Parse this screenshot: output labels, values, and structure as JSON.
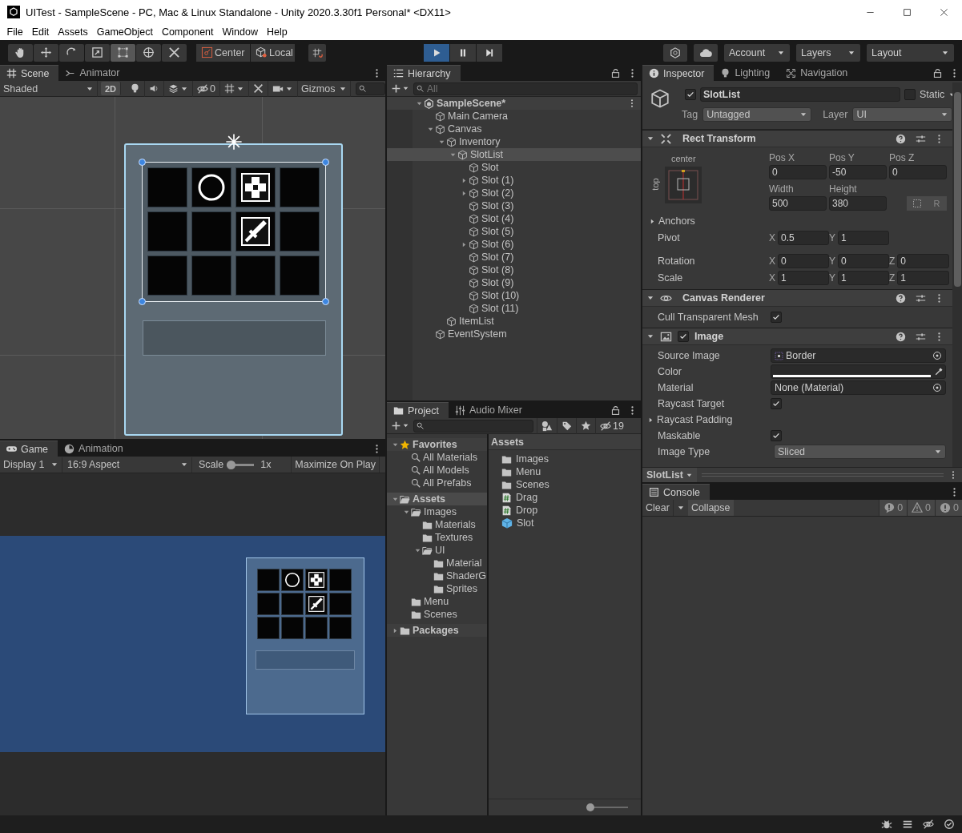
{
  "window": {
    "title": "UITest - SampleScene - PC, Mac & Linux Standalone - Unity 2020.3.30f1 Personal* <DX11>"
  },
  "menu": [
    "File",
    "Edit",
    "Assets",
    "GameObject",
    "Component",
    "Window",
    "Help"
  ],
  "toolbar": {
    "tools": [
      {
        "kind": "hand",
        "selected": false
      },
      {
        "kind": "move",
        "selected": false
      },
      {
        "kind": "rotate",
        "selected": false
      },
      {
        "kind": "scale",
        "selected": false
      },
      {
        "kind": "rect",
        "selected": true
      },
      {
        "kind": "transform",
        "selected": false
      },
      {
        "kind": "custom",
        "selected": false
      }
    ],
    "pivot": "Center",
    "space": "Local",
    "play": [
      {
        "kind": "play",
        "selected": true
      },
      {
        "kind": "pause",
        "selected": false
      },
      {
        "kind": "step",
        "selected": false
      }
    ],
    "account": "Account",
    "layers": "Layers",
    "layout": "Layout"
  },
  "inventory": {
    "slots": [
      {
        "kind": "empty"
      },
      {
        "kind": "ring"
      },
      {
        "kind": "cross"
      },
      {
        "kind": "empty"
      },
      {
        "kind": "empty"
      },
      {
        "kind": "empty"
      },
      {
        "kind": "sword"
      },
      {
        "kind": "empty"
      },
      {
        "kind": "empty"
      },
      {
        "kind": "empty"
      },
      {
        "kind": "empty"
      },
      {
        "kind": "empty"
      }
    ]
  },
  "scene": {
    "tabs": [
      {
        "label": "Scene",
        "selected": true
      },
      {
        "label": "Animator",
        "selected": false
      }
    ],
    "draw_mode": "Shaded",
    "mode_2d": "2D",
    "hidden_count": "0",
    "gizmos": "Gizmos"
  },
  "game": {
    "tabs": [
      {
        "label": "Game",
        "selected": true
      },
      {
        "label": "Animation",
        "selected": false
      }
    ],
    "display": "Display 1",
    "aspect": "16:9 Aspect",
    "scale_label": "Scale",
    "scale_slider": {
      "level": 0
    },
    "scale": "1x",
    "maximize": "Maximize On Play"
  },
  "hierarchy": {
    "tabs": [
      {
        "label": "Hierarchy",
        "selected": true
      }
    ],
    "search_placeholder": "All",
    "tree": [
      {
        "name": "SampleScene*",
        "kind": "scene",
        "expanded": true,
        "selected": false,
        "children": [
          {
            "name": "Main Camera",
            "selected": false
          },
          {
            "name": "Canvas",
            "expanded": true,
            "selected": false,
            "children": [
              {
                "name": "Inventory",
                "expanded": true,
                "selected": false,
                "children": [
                  {
                    "name": "SlotList",
                    "expanded": true,
                    "selected": true,
                    "children": [
                      {
                        "name": "Slot",
                        "selected": false
                      },
                      {
                        "name": "Slot (1)",
                        "expanded": false,
                        "selected": false
                      },
                      {
                        "name": "Slot (2)",
                        "expanded": false,
                        "selected": false
                      },
                      {
                        "name": "Slot (3)",
                        "selected": false
                      },
                      {
                        "name": "Slot (4)",
                        "selected": false
                      },
                      {
                        "name": "Slot (5)",
                        "selected": false
                      },
                      {
                        "name": "Slot (6)",
                        "expanded": false,
                        "selected": false
                      },
                      {
                        "name": "Slot (7)",
                        "selected": false
                      },
                      {
                        "name": "Slot (8)",
                        "selected": false
                      },
                      {
                        "name": "Slot (9)",
                        "selected": false
                      },
                      {
                        "name": "Slot (10)",
                        "selected": false
                      },
                      {
                        "name": "Slot (11)",
                        "selected": false
                      }
                    ]
                  }
                ]
              },
              {
                "name": "ItemList",
                "selected": false
              }
            ]
          },
          {
            "name": "EventSystem",
            "selected": false
          }
        ]
      }
    ]
  },
  "project": {
    "tabs": [
      {
        "label": "Project",
        "selected": true
      },
      {
        "label": "Audio Mixer",
        "selected": false
      }
    ],
    "hidden_count": "19",
    "tree": [
      {
        "name": "Favorites",
        "kind": "favorites",
        "expanded": true,
        "selected": false,
        "children": [
          {
            "name": "All Materials",
            "kind": "search",
            "selected": false
          },
          {
            "name": "All Models",
            "kind": "search",
            "selected": false
          },
          {
            "name": "All Prefabs",
            "kind": "search",
            "selected": false
          }
        ]
      },
      {
        "name": "Assets",
        "kind": "folder",
        "expanded": true,
        "selected": true,
        "children": [
          {
            "name": "Images",
            "kind": "folder",
            "expanded": true,
            "selected": false,
            "children": [
              {
                "name": "Materials",
                "kind": "folder",
                "selected": false
              },
              {
                "name": "Textures",
                "kind": "folder",
                "selected": false
              },
              {
                "name": "UI",
                "kind": "folder",
                "expanded": true,
                "selected": false,
                "children": [
                  {
                    "name": "Material",
                    "kind": "folder",
                    "selected": false
                  },
                  {
                    "name": "ShaderG",
                    "kind": "folder",
                    "selected": false
                  },
                  {
                    "name": "Sprites",
                    "kind": "folder",
                    "selected": false
                  }
                ]
              }
            ]
          },
          {
            "name": "Menu",
            "kind": "folder",
            "selected": false
          },
          {
            "name": "Scenes",
            "kind": "folder",
            "selected": false
          }
        ]
      },
      {
        "name": "Packages",
        "kind": "folder",
        "expanded": false,
        "selected": false
      }
    ],
    "breadcrumb": "Assets",
    "files": [
      {
        "name": "Images",
        "kind": "folder"
      },
      {
        "name": "Menu",
        "kind": "folder"
      },
      {
        "name": "Scenes",
        "kind": "folder"
      },
      {
        "name": "Drag",
        "kind": "script"
      },
      {
        "name": "Drop",
        "kind": "script"
      },
      {
        "name": "Slot",
        "kind": "prefab"
      }
    ],
    "zoom_slider": {
      "level": 0
    }
  },
  "inspector": {
    "tabs": [
      {
        "label": "Inspector",
        "selected": true
      },
      {
        "label": "Lighting",
        "selected": false
      },
      {
        "label": "Navigation",
        "selected": false
      }
    ],
    "object": {
      "active": true,
      "name": "SlotList",
      "static": false,
      "static_label": "Static",
      "tag_label": "Tag",
      "tag": "Untagged",
      "layer_label": "Layer",
      "layer": "UI"
    },
    "rect_transform": {
      "title": "Rect Transform",
      "expanded": true,
      "anchor_h": "center",
      "anchor_v": "top",
      "position": [
        {
          "label": "Pos X",
          "value": "0"
        },
        {
          "label": "Pos Y",
          "value": "-50"
        },
        {
          "label": "Pos Z",
          "value": "0"
        }
      ],
      "size": [
        {
          "label": "Width",
          "value": "500"
        },
        {
          "label": "Height",
          "value": "380"
        }
      ],
      "raw_button": "R",
      "anchors": "Anchors",
      "anchors_expanded": false,
      "rows": [
        {
          "label": "Pivot",
          "fields": [
            {
              "axis": "X",
              "value": "0.5"
            },
            {
              "axis": "Y",
              "value": "1"
            }
          ]
        },
        {
          "label": "Rotation",
          "fields": [
            {
              "axis": "X",
              "value": "0"
            },
            {
              "axis": "Y",
              "value": "0"
            },
            {
              "axis": "Z",
              "value": "0"
            }
          ]
        },
        {
          "label": "Scale",
          "fields": [
            {
              "axis": "X",
              "value": "1"
            },
            {
              "axis": "Y",
              "value": "1"
            },
            {
              "axis": "Z",
              "value": "1"
            }
          ]
        }
      ]
    },
    "components": [
      {
        "title": "Canvas Renderer",
        "kind": "canvas_renderer",
        "expanded": true,
        "rows": [
          {
            "label": "Cull Transparent Mesh",
            "kind": "checkbox",
            "checked": true
          }
        ]
      },
      {
        "title": "Image",
        "kind": "image",
        "enabled": true,
        "expanded": true,
        "rows": [
          {
            "label": "Source Image",
            "kind": "sprite",
            "value": "Border"
          },
          {
            "label": "Color",
            "kind": "color"
          },
          {
            "label": "Material",
            "kind": "object",
            "value": "None (Material)"
          },
          {
            "label": "Raycast Target",
            "kind": "checkbox",
            "checked": true
          },
          {
            "label": "Raycast Padding",
            "kind": "foldout",
            "expanded": false
          },
          {
            "label": "Maskable",
            "kind": "checkbox",
            "checked": true
          },
          {
            "label": "Image Type",
            "kind": "dropdown",
            "value": "Sliced"
          }
        ]
      }
    ],
    "preview": "SlotList"
  },
  "console": {
    "tabs": [
      {
        "label": "Console",
        "selected": true
      }
    ],
    "clear": "Clear",
    "collapse": "Collapse",
    "counts": [
      {
        "kind": "log",
        "count": "0"
      },
      {
        "kind": "warning",
        "count": "0"
      },
      {
        "kind": "error",
        "count": "0"
      }
    ]
  }
}
